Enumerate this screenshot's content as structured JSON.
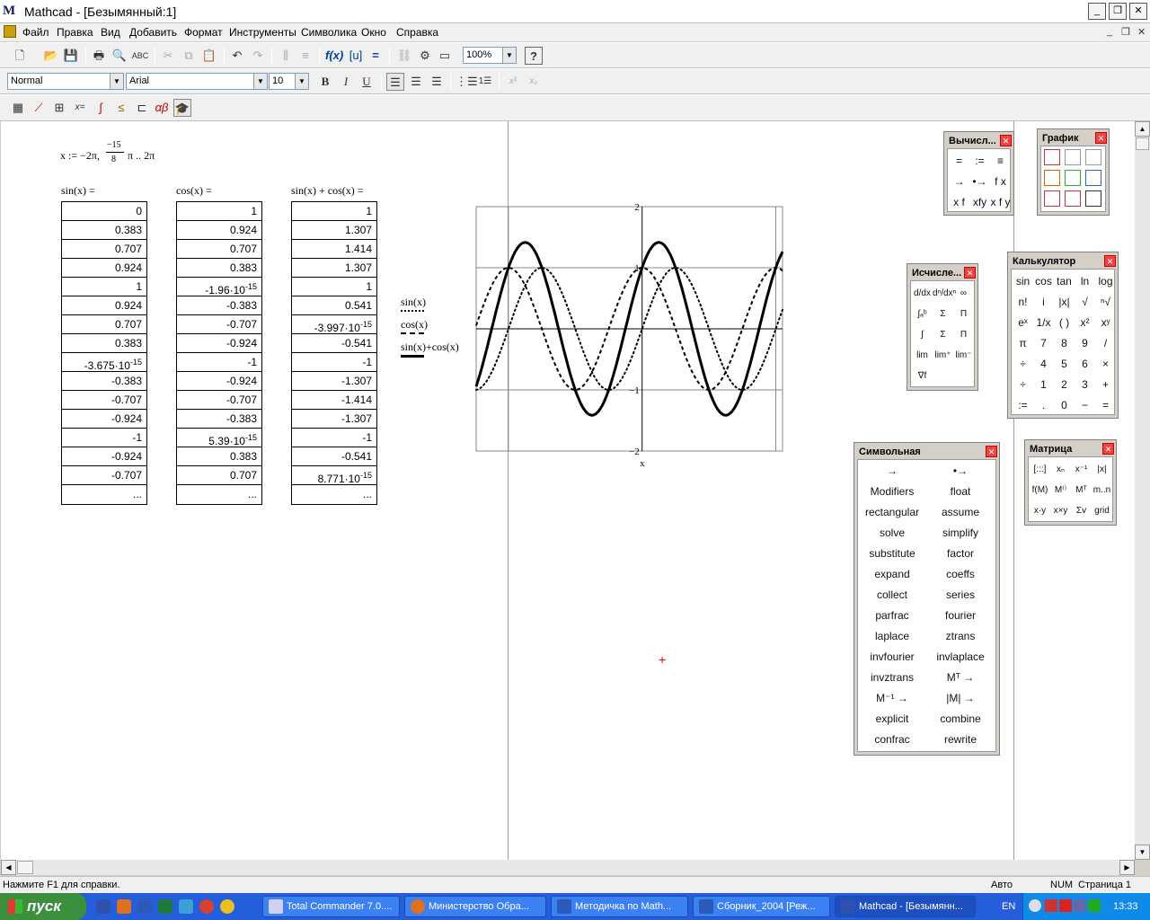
{
  "window": {
    "title": "Mathcad - [Безымянный:1]",
    "icon": "mathcad-icon"
  },
  "menu": [
    "Файл",
    "Правка",
    "Вид",
    "Добавить",
    "Формат",
    "Инструменты",
    "Символика",
    "Окно",
    "Справка"
  ],
  "toolbar": {
    "zoom": "100%",
    "style": "Normal",
    "font": "Arial",
    "size": "10"
  },
  "worksheet": {
    "range_def": {
      "lhs": "x",
      "assign": ":=",
      "start": "−2π",
      "num": "−15",
      "den": "8",
      "step_suffix": "π",
      "dots": "..",
      "end": "2π"
    },
    "tables": [
      {
        "header": "sin(x) =",
        "values": [
          "0",
          "0.383",
          "0.707",
          "0.924",
          "1",
          "0.924",
          "0.707",
          "0.383",
          "-3.675·10",
          "-0.383",
          "-0.707",
          "-0.924",
          "-1",
          "-0.924",
          "-0.707",
          "..."
        ],
        "exps": {
          "8": "-15"
        }
      },
      {
        "header": "cos(x) =",
        "values": [
          "1",
          "0.924",
          "0.707",
          "0.383",
          "-1.96·10",
          "-0.383",
          "-0.707",
          "-0.924",
          "-1",
          "-0.924",
          "-0.707",
          "-0.383",
          "5.39·10",
          "0.383",
          "0.707",
          "..."
        ],
        "exps": {
          "4": "-15",
          "12": "-15"
        }
      },
      {
        "header": "sin(x) + cos(x) =",
        "values": [
          "1",
          "1.307",
          "1.414",
          "1.307",
          "1",
          "0.541",
          "-3.997·10",
          "-0.541",
          "-1",
          "-1.307",
          "-1.414",
          "-1.307",
          "-1",
          "-0.541",
          "8.771·10",
          "..."
        ],
        "exps": {
          "6": "-15",
          "14": "-15"
        }
      }
    ],
    "legend": [
      "sin(x)",
      "cos(x)",
      "sin(x)+cos(x)"
    ],
    "cursor": "+"
  },
  "chart_data": {
    "type": "line",
    "xlabel": "x",
    "ylabel": "",
    "xlim": [
      -7.8,
      6.6
    ],
    "ylim": [
      -2,
      2
    ],
    "yticks": [
      "2",
      "1",
      "−1",
      "−2"
    ],
    "series": [
      {
        "name": "sin(x)",
        "fn": "sin",
        "style": "dotted"
      },
      {
        "name": "cos(x)",
        "fn": "cos",
        "style": "dashed"
      },
      {
        "name": "sin(x)+cos(x)",
        "fn": "sum",
        "style": "solid-bold"
      }
    ],
    "grid": true
  },
  "palettes": {
    "evaluation": {
      "title": "Вычисл...",
      "buttons": [
        "=",
        ":=",
        "≡",
        "→",
        "•→",
        "f x",
        "x f",
        "xfy",
        "x f y"
      ]
    },
    "graph": {
      "title": "График",
      "buttons": [
        "xy-plot-icon",
        "polar-plot-icon",
        "surface-plot-icon",
        "contour-plot-icon",
        "3d-scatter-icon",
        "vector-field-icon",
        "3d-bar-icon",
        "scatter-icon",
        "zoom-icon"
      ]
    },
    "calculus": {
      "title": "Исчисле...",
      "buttons": [
        "d/dx",
        "dⁿ/dxⁿ",
        "∞",
        "∫ₐᵇ",
        "Σ",
        "Π",
        "∫",
        "Σ",
        "Π",
        "lim",
        "lim⁺",
        "lim⁻",
        "∇f"
      ]
    },
    "calculator": {
      "title": "Калькулятор",
      "buttons": [
        "sin",
        "cos",
        "tan",
        "ln",
        "log",
        "n!",
        "i",
        "|x|",
        "√",
        "ⁿ√",
        "eˣ",
        "1/x",
        "( )",
        "x²",
        "xʸ",
        "π",
        "7",
        "8",
        "9",
        "/",
        "÷",
        "4",
        "5",
        "6",
        "×",
        "÷",
        "1",
        "2",
        "3",
        "+",
        ":=",
        ".",
        "0",
        "−",
        "="
      ]
    },
    "matrix": {
      "title": "Матрица",
      "buttons": [
        "[:::]",
        "xₙ",
        "x⁻¹",
        "|x|",
        "f(M)",
        "M⁽⁾",
        "Mᵀ",
        "m..n",
        "x·y",
        "x×y",
        "Σv",
        "grid"
      ]
    },
    "symbolic": {
      "title": "Символьная",
      "buttons": [
        "→",
        "•→",
        "Modifiers",
        "float",
        "rectangular",
        "assume",
        "solve",
        "simplify",
        "substitute",
        "factor",
        "expand",
        "coeffs",
        "collect",
        "series",
        "parfrac",
        "fourier",
        "laplace",
        "ztrans",
        "invfourier",
        "invlaplace",
        "invztrans",
        "Mᵀ →",
        "M⁻¹ →",
        "|M| →",
        "explicit",
        "combine",
        "confrac",
        "rewrite"
      ]
    }
  },
  "status": {
    "help": "Нажмите F1 для справки.",
    "mode": "Авто",
    "num": "NUM",
    "page": "Страница 1"
  },
  "taskbar": {
    "start": "пуск",
    "tasks": [
      "Total Commander 7.0....",
      "Министерство Обра...",
      "Методичка по Math...",
      "Сборник_2004 [Реж...",
      "Mathcad - [Безымянн..."
    ],
    "lang": "EN",
    "clock": "13:33"
  }
}
